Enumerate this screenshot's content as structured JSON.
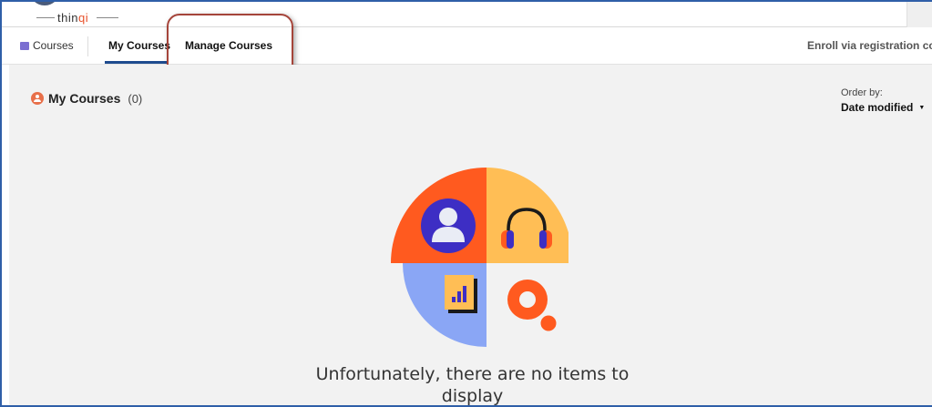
{
  "logo": {
    "text_main": "thin",
    "text_accent": "qi"
  },
  "nav": {
    "courses": "Courses",
    "my_courses": "My Courses",
    "manage_courses": "Manage Courses",
    "enroll": "Enroll via registration cod"
  },
  "main": {
    "title": "My Courses",
    "count": "(0)",
    "order_label": "Order by:",
    "order_value": "Date modified",
    "empty_message": "Unfortunately, there are no items to display"
  },
  "icons": {
    "courses": "book-icon",
    "title": "user-icon",
    "order": "caret-down-icon",
    "illustration": [
      "user-avatar-icon",
      "headphones-icon",
      "chart-icon",
      "search-icon"
    ]
  },
  "colors": {
    "accent_orange": "#ff5a1f",
    "accent_yellow": "#ffbe55",
    "accent_blue": "#8aa6f5",
    "nav_underline": "#1f4c8f",
    "highlight": "#a5443a",
    "content_bg": "#f2f2f2"
  }
}
